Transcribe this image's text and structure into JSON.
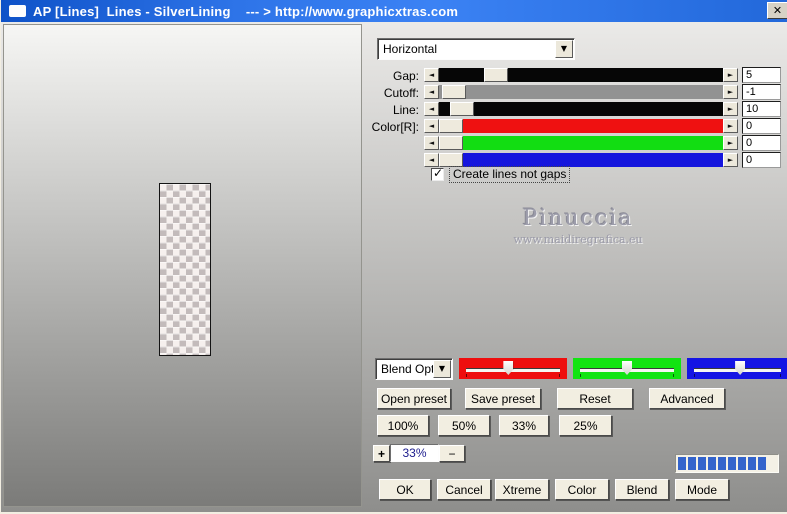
{
  "window": {
    "title": "AP [Lines]  Lines - SilverLining    --- > http://www.graphicxtras.com"
  },
  "icons": {
    "close": "✕",
    "down": "▼",
    "left": "◄",
    "right": "►",
    "check": "✓"
  },
  "direction_dropdown": {
    "value": "Horizontal"
  },
  "sliders": [
    {
      "label": "Gap:",
      "value": "5",
      "track_color": "#060606",
      "thumb_pct": 16
    },
    {
      "label": "Cutoff:",
      "value": "-1",
      "track_color": "#929292",
      "thumb_pct": 1
    },
    {
      "label": "Line:",
      "value": "10",
      "track_color": "#060606",
      "thumb_pct": 4
    },
    {
      "label": "Color[R]:",
      "value": "0",
      "track_color": "#ef1111",
      "thumb_pct": 0
    },
    {
      "label": "",
      "value": "0",
      "track_color": "#12dd12",
      "thumb_pct": 0
    },
    {
      "label": "",
      "value": "0",
      "track_color": "#1515dd",
      "thumb_pct": 0
    }
  ],
  "checkbox": {
    "label": "Create lines not gaps",
    "checked": true
  },
  "watermark": {
    "name": "Pinuccia",
    "site": "www.maidiregrafica.eu"
  },
  "blend_dropdown": {
    "value": "Blend Opti"
  },
  "channels": [
    {
      "name": "red",
      "color": "#ee0e0e",
      "thumb_pct": 45
    },
    {
      "name": "green",
      "color": "#12e412",
      "thumb_pct": 50
    },
    {
      "name": "blue",
      "color": "#1414e4",
      "thumb_pct": 53
    }
  ],
  "preset_buttons": {
    "open": "Open preset",
    "save": "Save preset",
    "reset": "Reset",
    "advanced": "Advanced"
  },
  "zoom_buttons": {
    "b100": "100%",
    "b50": "50%",
    "b33": "33%",
    "b25": "25%"
  },
  "zoom_control": {
    "plus": "+",
    "value": "33%",
    "minus": "−"
  },
  "progress": {
    "segments": 9,
    "color": "#3464cc"
  },
  "action_buttons": {
    "ok": "OK",
    "cancel": "Cancel",
    "xtreme": "Xtreme",
    "color": "Color",
    "blend": "Blend",
    "mode": "Mode"
  }
}
